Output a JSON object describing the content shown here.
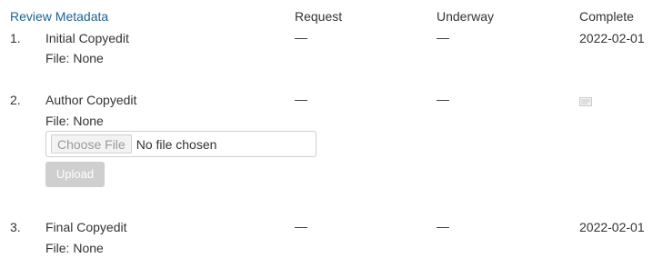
{
  "header": {
    "review_metadata": "Review Metadata",
    "request": "Request",
    "underway": "Underway",
    "complete": "Complete"
  },
  "rows": [
    {
      "number": "1.",
      "title": "Initial Copyedit",
      "file": "File: None",
      "request": "—",
      "underway": "—",
      "complete": "2022-02-01"
    },
    {
      "number": "2.",
      "title": "Author Copyedit",
      "file": "File: None",
      "request": "—",
      "underway": "—",
      "complete_icon": "mail-icon",
      "file_input": {
        "choose_label": "Choose File",
        "status": "No file chosen"
      },
      "upload_label": "Upload"
    },
    {
      "number": "3.",
      "title": "Final Copyedit",
      "file": "File: None",
      "request": "—",
      "underway": "—",
      "complete": "2022-02-01"
    }
  ],
  "colors": {
    "link": "#1e6292",
    "text": "#333333",
    "disabled_button": "#cfcfcf"
  }
}
